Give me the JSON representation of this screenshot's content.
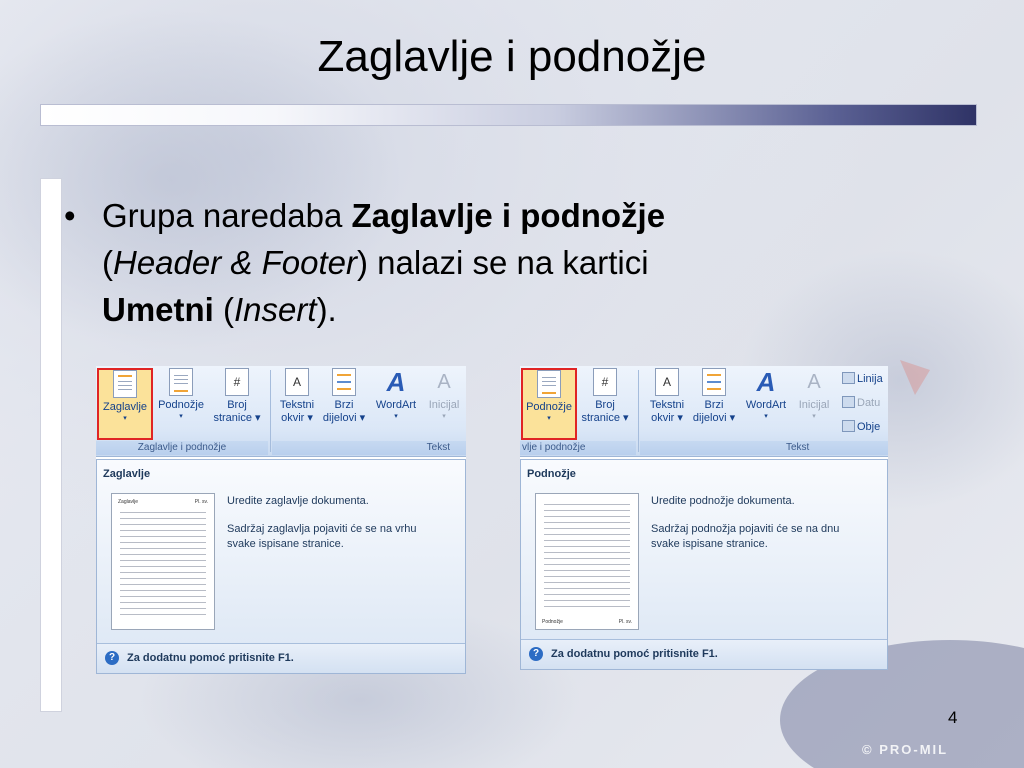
{
  "slide": {
    "title": "Zaglavlje i podnožje",
    "bullet": {
      "marker": "•",
      "part1": "Grupa naredaba ",
      "bold1": "Zaglavlje i podnožje",
      "part2": " (",
      "italic1": "Header & Footer",
      "part3": ") nalazi se na kartici ",
      "bold2": "Umetni",
      "part4": " (",
      "italic2": "Insert",
      "part5": ")."
    },
    "page_number": "4",
    "copyright": "© PRO-MIL"
  },
  "left_screenshot": {
    "buttons": [
      {
        "label1": "Zaglavlje",
        "label2": "▾"
      },
      {
        "label1": "Podnožje",
        "label2": "▾"
      },
      {
        "label1": "Broj",
        "label2": "stranice ▾"
      }
    ],
    "group1_label": "Zaglavlje i podnožje",
    "text_buttons": [
      {
        "label1": "Tekstni",
        "label2": "okvir ▾"
      },
      {
        "label1": "Brzi",
        "label2": "dijelovi ▾"
      },
      {
        "label1": "WordArt",
        "label2": "▾"
      },
      {
        "label1": "Inicijal",
        "label2": "▾"
      }
    ],
    "group2_label": "Tekst",
    "dropdown": {
      "title": "Zaglavlje",
      "thumb_left": "Zaglavlje",
      "thumb_right": "Pl. sv.",
      "desc1": "Uredite zaglavlje dokumenta.",
      "desc2": "Sadržaj zaglavlja pojaviti će se na vrhu svake ispisane stranice.",
      "help": "Za dodatnu pomoć pritisnite F1."
    }
  },
  "right_screenshot": {
    "buttons": [
      {
        "label1": "Podnožje",
        "label2": "▾"
      },
      {
        "label1": "Broj",
        "label2": "stranice ▾"
      }
    ],
    "group1_label": "vlje i podnožje",
    "text_buttons": [
      {
        "label1": "Tekstni",
        "label2": "okvir ▾"
      },
      {
        "label1": "Brzi",
        "label2": "dijelovi ▾"
      },
      {
        "label1": "WordArt",
        "label2": "▾"
      },
      {
        "label1": "Inicijal",
        "label2": "▾"
      }
    ],
    "group2_label": "Tekst",
    "side_items": [
      "Linija",
      "Datu",
      "Obje"
    ],
    "dropdown": {
      "title": "Podnožje",
      "thumb_left": "Podnožje",
      "thumb_right": "Pl. sv.",
      "desc1": "Uredite podnožje dokumenta.",
      "desc2": "Sadržaj podnožja pojaviti će se na dnu svake ispisane stranice.",
      "help": "Za dodatnu pomoć pritisnite F1."
    }
  },
  "colors": {
    "active_border": "#e02424",
    "active_fill": "#fbe29a",
    "ribbon_text": "#15428b",
    "title_bar_dark": "#2f3366"
  }
}
